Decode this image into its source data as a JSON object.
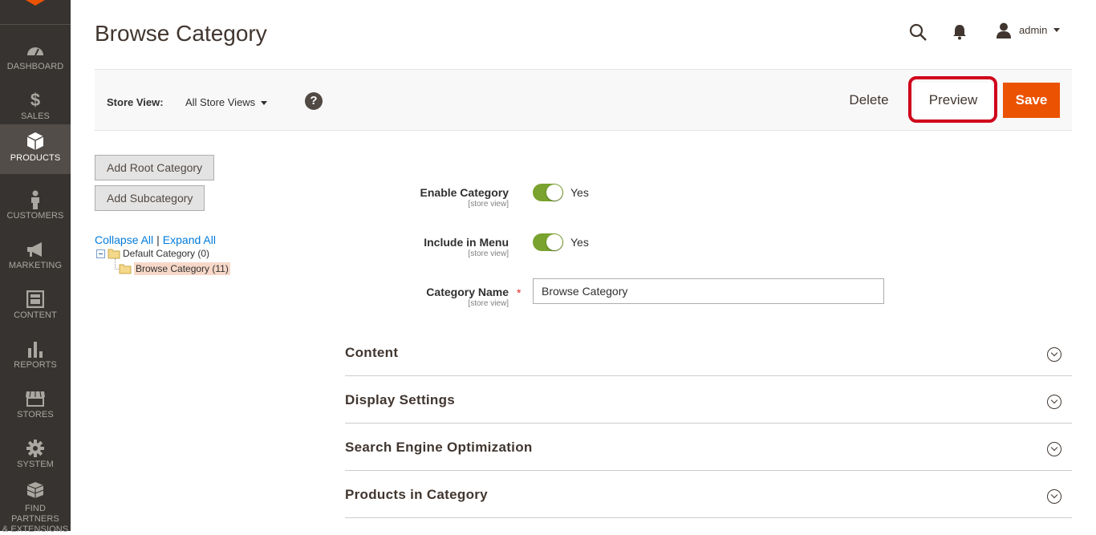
{
  "page": {
    "title": "Browse Category"
  },
  "header": {
    "admin_name": "admin"
  },
  "sidebar": {
    "items": [
      {
        "label": "DASHBOARD",
        "icon": "dashboard-icon"
      },
      {
        "label": "SALES",
        "icon": "dollar-icon"
      },
      {
        "label": "PRODUCTS",
        "icon": "box-icon",
        "active": true
      },
      {
        "label": "CUSTOMERS",
        "icon": "person-icon"
      },
      {
        "label": "MARKETING",
        "icon": "megaphone-icon"
      },
      {
        "label": "CONTENT",
        "icon": "layout-icon"
      },
      {
        "label": "REPORTS",
        "icon": "bar-chart-icon"
      },
      {
        "label": "STORES",
        "icon": "storefront-icon"
      },
      {
        "label": "SYSTEM",
        "icon": "gear-icon"
      },
      {
        "label_line1": "FIND PARTNERS",
        "label_line2": "& EXTENSIONS",
        "icon": "blocks-icon"
      }
    ]
  },
  "toolbar": {
    "store_view_label": "Store View:",
    "store_view_value": "All Store Views",
    "help_label": "?",
    "delete_label": "Delete",
    "preview_label": "Preview",
    "save_label": "Save"
  },
  "tree": {
    "add_root_label": "Add Root Category",
    "add_sub_label": "Add Subcategory",
    "collapse_all": "Collapse All",
    "separator": "|",
    "expand_all": "Expand All",
    "nodes": [
      {
        "label": "Default Category (0)"
      },
      {
        "label": "Browse Category (11)",
        "selected": true
      }
    ]
  },
  "form": {
    "enable_category": {
      "label": "Enable Category",
      "scope": "[store view]",
      "value": "Yes",
      "checked": true
    },
    "include_in_menu": {
      "label": "Include in Menu",
      "scope": "[store view]",
      "value": "Yes",
      "checked": true
    },
    "category_name": {
      "label": "Category Name",
      "scope": "[store view]",
      "required_mark": "*",
      "value": "Browse Category"
    }
  },
  "sections": [
    {
      "title": "Content"
    },
    {
      "title": "Display Settings"
    },
    {
      "title": "Search Engine Optimization"
    },
    {
      "title": "Products in Category"
    }
  ],
  "colors": {
    "sidebar_bg": "#373330",
    "accent_orange": "#eb5202",
    "toggle_on": "#79a22e",
    "highlight_red": "#d0021b",
    "link_blue": "#007bdb"
  }
}
